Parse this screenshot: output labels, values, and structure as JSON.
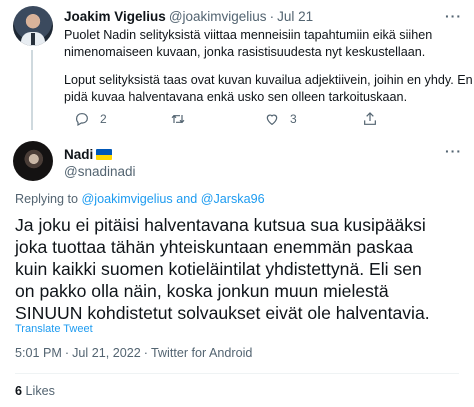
{
  "parent_tweet": {
    "author_name": "Joakim Vigelius",
    "author_handle": "@joakimvigelius",
    "date": "Jul 21",
    "lines": [
      "Puolet Nadin selityksistä viittaa menneisiin tapahtumiin eikä siihen",
      "nimenomaiseen kuvaan, jonka rasistisuudesta nyt keskustellaan.",
      "Loput selityksistä taas ovat kuvan kuvailua adjektiivein, joihin en yhdy. En",
      "pidä kuvaa halventavana enkä usko sen olleen tarkoituskaan."
    ],
    "reply_count": "2",
    "retweet_count": "",
    "like_count": "3"
  },
  "main_tweet": {
    "author_name": "Nadi",
    "author_handle": "@snadinadi",
    "replying_prefix": "Replying to",
    "replying_user1": "@joakimvigelius",
    "replying_and": "and",
    "replying_user2": "@Jarska96",
    "lines": [
      "Ja joku ei pitäisi halventavana kutsua sua kusipääksi",
      "joka tuottaa tähän yhteiskuntaan enemmän paskaa",
      "kuin kaikki suomen kotieläintilat yhdistettynä. Eli sen",
      "on pakko olla näin, koska jonkun muun mielestä",
      "SINUUN kohdistetut solvaukset eivät ole halventavia."
    ],
    "translate_label": "Translate Tweet",
    "time": "5:01 PM",
    "date": "Jul 21, 2022",
    "source": "Twitter for Android",
    "likes_count": "6",
    "likes_label": "Likes"
  },
  "colors": {
    "accent": "#1d9bf0",
    "secondary_text": "#536471",
    "flag_blue": "#0057b7",
    "flag_yellow": "#ffd700"
  },
  "icons": [
    "more-icon",
    "reply-icon",
    "retweet-icon",
    "like-icon",
    "share-icon",
    "ukraine-flag-icon"
  ]
}
